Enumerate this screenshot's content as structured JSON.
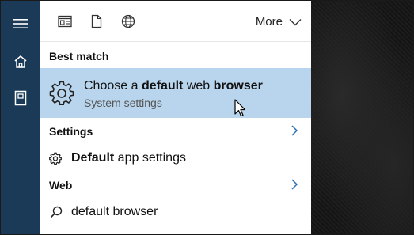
{
  "toolbar": {
    "more_label": "More"
  },
  "sections": {
    "best_match": "Best match",
    "settings": "Settings",
    "web": "Web"
  },
  "best_match_item": {
    "title_pre": "Choose a ",
    "title_bold1": "default",
    "title_mid": " web ",
    "title_bold2": "browser",
    "subtitle": "System settings"
  },
  "settings_item": {
    "bold": "Default",
    "rest": " app settings"
  },
  "web_item": {
    "text": "default browser"
  },
  "colors": {
    "rail": "#1b3a57",
    "highlight": "#b9d5ed",
    "panel": "#ffffff"
  },
  "icons": {
    "rail": [
      "hamburger-icon",
      "home-icon",
      "notebook-icon"
    ],
    "toolbar": [
      "apps-icon",
      "documents-icon",
      "web-icon"
    ],
    "items": [
      "gear-icon",
      "small-gear-icon",
      "search-icon",
      "chevron-right-icon",
      "chevron-down-icon"
    ]
  }
}
